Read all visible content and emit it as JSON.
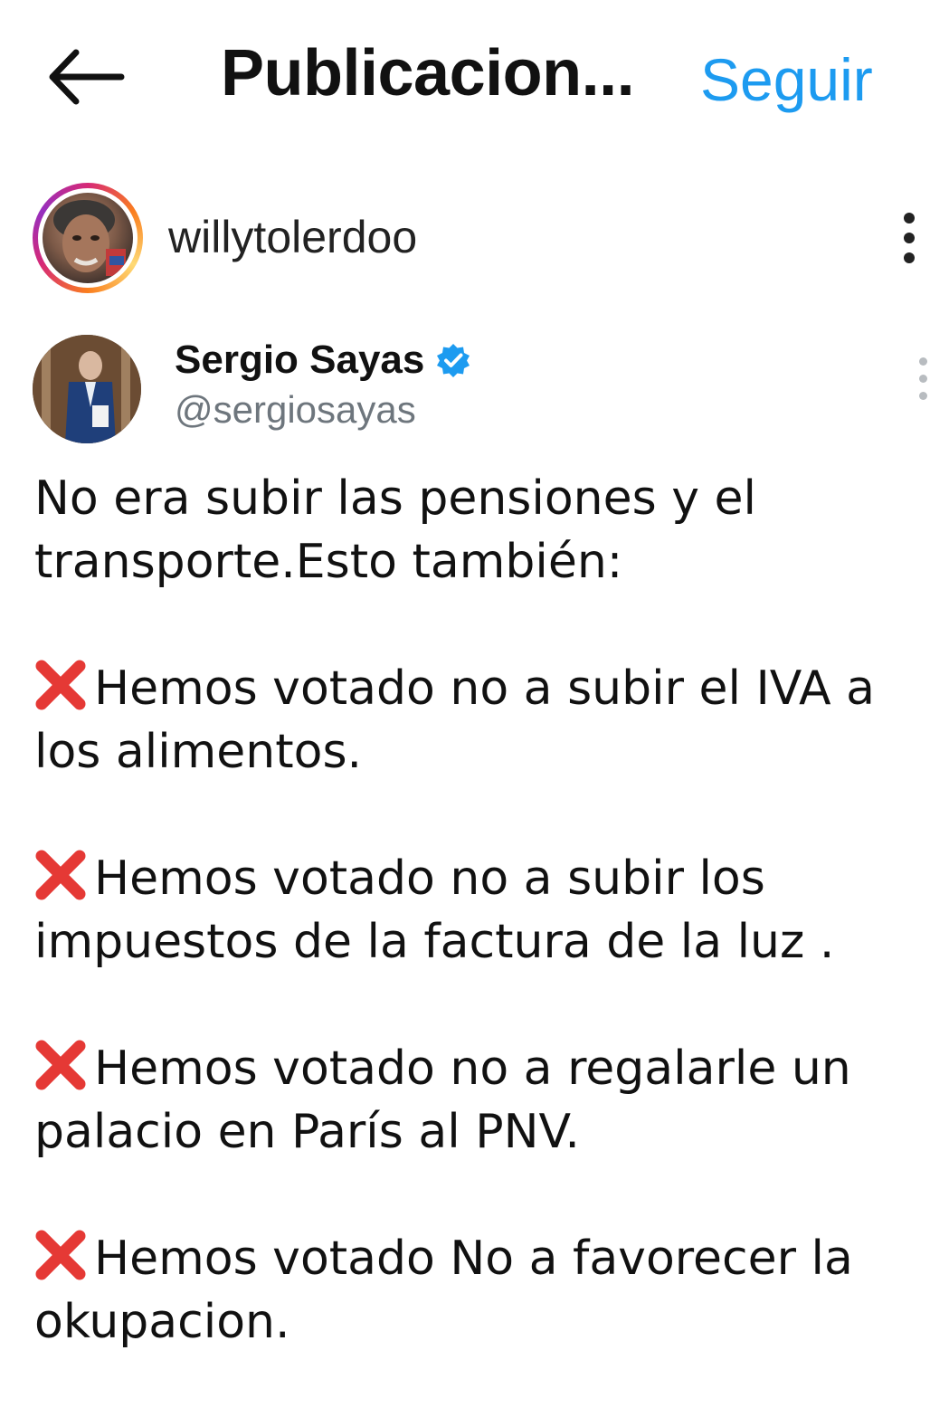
{
  "header": {
    "title": "Publicacion...",
    "follow_label": "Seguir",
    "back_icon": "arrow-left-icon"
  },
  "post": {
    "username": "willytolerdoo",
    "menu_icon": "more-vertical-icon"
  },
  "tweet": {
    "author_name": "Sergio Sayas",
    "verified": true,
    "handle": "@sergiosayas",
    "paragraphs": [
      "No era subir las pensiones y el transporte.Esto también:"
    ],
    "items": [
      "Hemos votado no a subir el IVA a los alimentos.",
      "Hemos votado no a subir los impuestos de la factura de la luz .",
      "Hemos votado no a regalarle un palacio en París al PNV.",
      "Hemos votado No a favorecer la okupacion."
    ],
    "item_icon": "red-x-icon"
  },
  "colors": {
    "accent": "#1d9bf0",
    "verified": "#1d9bf0",
    "x_mark": "#e53935",
    "handle": "#6e767d"
  }
}
